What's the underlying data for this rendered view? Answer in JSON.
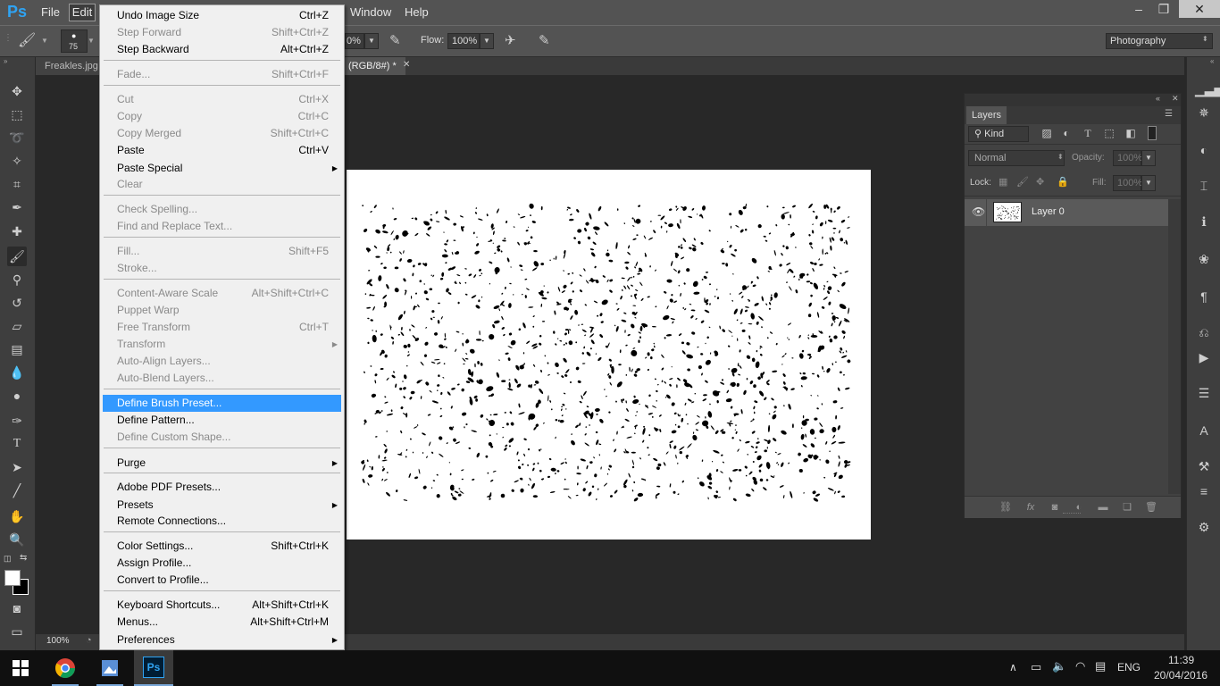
{
  "app": {
    "logo": "Ps"
  },
  "menubar": {
    "items": [
      "File",
      "Edit",
      "Window",
      "Help"
    ],
    "window_controls": [
      "–",
      "❐",
      "✕"
    ]
  },
  "options_bar": {
    "brush_size": "75",
    "opacity_partial": "0%",
    "flow_label": "Flow:",
    "flow_value": "100%",
    "workspace": "Photography"
  },
  "tabs": {
    "tab1": "Freakles.jpg",
    "tab2": "(RGB/8#) *",
    "tab2_close": "✕"
  },
  "status": {
    "zoom": "100%"
  },
  "edit_menu": {
    "items": [
      {
        "label": "Undo Image Size",
        "shortcut": "Ctrl+Z",
        "disabled": false
      },
      {
        "label": "Step Forward",
        "shortcut": "Shift+Ctrl+Z",
        "disabled": true
      },
      {
        "label": "Step Backward",
        "shortcut": "Alt+Ctrl+Z",
        "disabled": false
      },
      {
        "label": "Fade...",
        "shortcut": "Shift+Ctrl+F",
        "disabled": true
      },
      {
        "label": "Cut",
        "shortcut": "Ctrl+X",
        "disabled": true
      },
      {
        "label": "Copy",
        "shortcut": "Ctrl+C",
        "disabled": true
      },
      {
        "label": "Copy Merged",
        "shortcut": "Shift+Ctrl+C",
        "disabled": true
      },
      {
        "label": "Paste",
        "shortcut": "Ctrl+V",
        "disabled": false
      },
      {
        "label": "Paste Special",
        "shortcut": "",
        "disabled": false,
        "submenu": true
      },
      {
        "label": "Clear",
        "shortcut": "",
        "disabled": true
      },
      {
        "label": "Check Spelling...",
        "shortcut": "",
        "disabled": true
      },
      {
        "label": "Find and Replace Text...",
        "shortcut": "",
        "disabled": true
      },
      {
        "label": "Fill...",
        "shortcut": "Shift+F5",
        "disabled": true
      },
      {
        "label": "Stroke...",
        "shortcut": "",
        "disabled": true
      },
      {
        "label": "Content-Aware Scale",
        "shortcut": "Alt+Shift+Ctrl+C",
        "disabled": true
      },
      {
        "label": "Puppet Warp",
        "shortcut": "",
        "disabled": true
      },
      {
        "label": "Free Transform",
        "shortcut": "Ctrl+T",
        "disabled": true
      },
      {
        "label": "Transform",
        "shortcut": "",
        "disabled": true,
        "submenu": true
      },
      {
        "label": "Auto-Align Layers...",
        "shortcut": "",
        "disabled": true
      },
      {
        "label": "Auto-Blend Layers...",
        "shortcut": "",
        "disabled": true
      },
      {
        "label": "Define Brush Preset...",
        "shortcut": "",
        "disabled": false,
        "selected": true
      },
      {
        "label": "Define Pattern...",
        "shortcut": "",
        "disabled": false
      },
      {
        "label": "Define Custom Shape...",
        "shortcut": "",
        "disabled": true
      },
      {
        "label": "Purge",
        "shortcut": "",
        "disabled": false,
        "submenu": true
      },
      {
        "label": "Adobe PDF Presets...",
        "shortcut": "",
        "disabled": false
      },
      {
        "label": "Presets",
        "shortcut": "",
        "disabled": false,
        "submenu": true
      },
      {
        "label": "Remote Connections...",
        "shortcut": "",
        "disabled": false
      },
      {
        "label": "Color Settings...",
        "shortcut": "Shift+Ctrl+K",
        "disabled": false
      },
      {
        "label": "Assign Profile...",
        "shortcut": "",
        "disabled": false
      },
      {
        "label": "Convert to Profile...",
        "shortcut": "",
        "disabled": false
      },
      {
        "label": "Keyboard Shortcuts...",
        "shortcut": "Alt+Shift+Ctrl+K",
        "disabled": false
      },
      {
        "label": "Menus...",
        "shortcut": "Alt+Shift+Ctrl+M",
        "disabled": false
      },
      {
        "label": "Preferences",
        "shortcut": "",
        "disabled": false,
        "submenu": true
      }
    ]
  },
  "layers_panel": {
    "title": "Layers",
    "filter": "Kind",
    "blend_mode": "Normal",
    "opacity_label": "Opacity:",
    "opacity_value": "100%",
    "lock_label": "Lock:",
    "fill_label": "Fill:",
    "fill_value": "100%",
    "layer_name": "Layer 0"
  },
  "taskbar": {
    "language": "ENG",
    "time": "11:39",
    "date": "20/04/2016"
  },
  "colors": {
    "accent": "#3399ff",
    "ps_blue": "#2fa3f2"
  }
}
